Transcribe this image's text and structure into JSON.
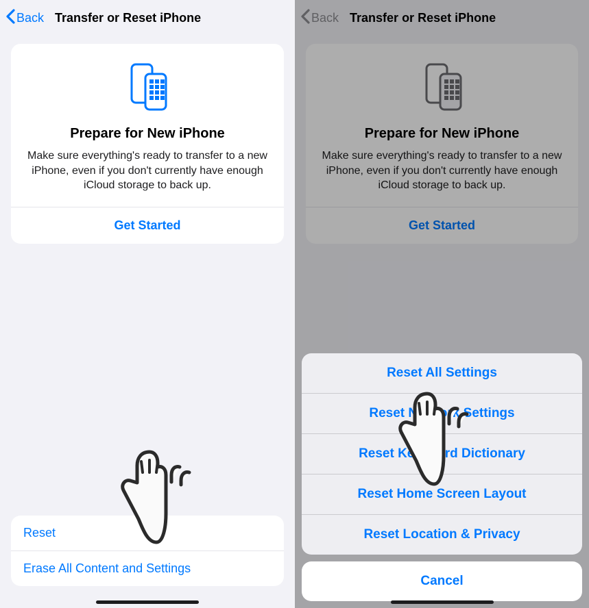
{
  "nav": {
    "back_label": "Back",
    "title": "Transfer or Reset iPhone"
  },
  "card": {
    "title": "Prepare for New iPhone",
    "description": "Make sure everything's ready to transfer to a new iPhone, even if you don't currently have enough iCloud storage to back up.",
    "action": "Get Started"
  },
  "bottom": {
    "reset": "Reset",
    "erase": "Erase All Content and Settings"
  },
  "sheet": {
    "items": [
      "Reset All Settings",
      "Reset Network Settings",
      "Reset Keyboard Dictionary",
      "Reset Home Screen Layout",
      "Reset Location & Privacy"
    ],
    "cancel": "Cancel"
  },
  "colors": {
    "accent": "#0079ff"
  }
}
